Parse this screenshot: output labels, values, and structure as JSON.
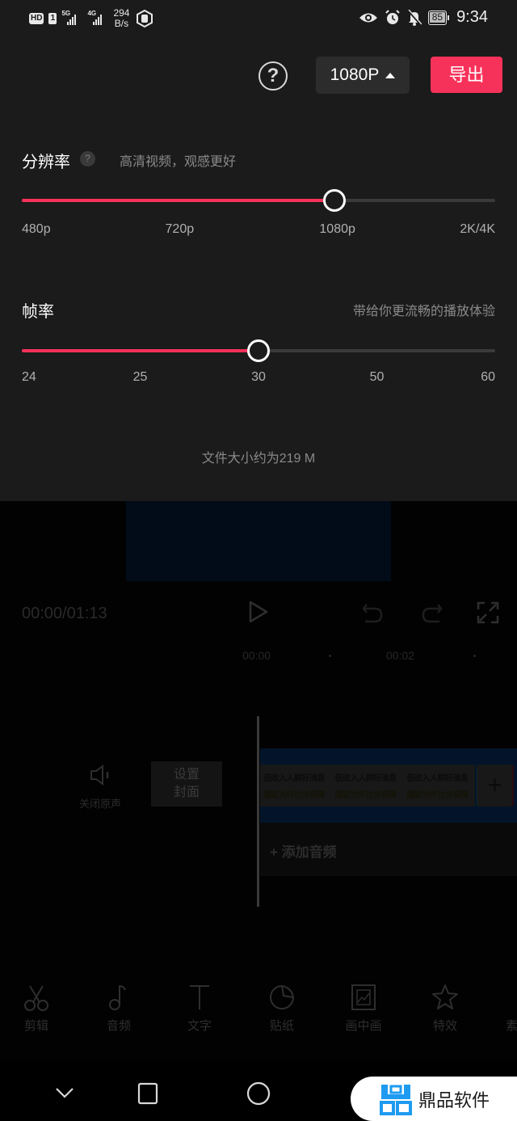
{
  "status_bar": {
    "hd_label": "HD",
    "sim_label": "1",
    "net1": "5G",
    "net2": "4G",
    "speed_value": "294",
    "speed_unit": "B/s",
    "battery": "85",
    "time": "9:34"
  },
  "export_panel": {
    "help_label": "?",
    "resolution_selected": "1080P",
    "export_label": "导出",
    "resolution": {
      "title": "分辨率",
      "help_badge": "?",
      "subtitle": "高清视频，观感更好",
      "options": [
        "480p",
        "720p",
        "1080p",
        "2K/4K"
      ],
      "selected": "1080p",
      "fill_fraction": 0.66
    },
    "frame_rate": {
      "title": "帧率",
      "subtitle": "带给你更流畅的播放体验",
      "options": [
        "24",
        "25",
        "30",
        "50",
        "60"
      ],
      "selected": "30",
      "fill_fraction": 0.5
    },
    "file_size": "文件大小约为219 M"
  },
  "editor": {
    "timecode": "00:00/01:13",
    "ruler_marks": [
      "00:00",
      "00:02"
    ],
    "mute_label": "关闭原声",
    "cover_label_1": "设置",
    "cover_label_2": "封面",
    "clip_frames": [
      {
        "line1": "低收入人群好消息",
        "line2": "国家关怀住房保障"
      },
      {
        "line1": "低收入人群好消息",
        "line2": "国家关怀住房保障"
      },
      {
        "line1": "低收入人群好消息",
        "line2": "国家关怀住房保障"
      }
    ],
    "add_clip_label": "+",
    "add_audio_label": "+ 添加音频",
    "tools": [
      {
        "label": "剪辑",
        "icon": "scissors-icon"
      },
      {
        "label": "音频",
        "icon": "music-note-icon"
      },
      {
        "label": "文字",
        "icon": "text-icon"
      },
      {
        "label": "贴纸",
        "icon": "sticker-icon"
      },
      {
        "label": "画中画",
        "icon": "picture-in-picture-icon"
      },
      {
        "label": "特效",
        "icon": "star-effect-icon"
      },
      {
        "label": "素",
        "icon": "material-icon"
      }
    ]
  },
  "nav_bar": {
    "watermark_text": "鼎品软件"
  },
  "colors": {
    "accent": "#f7325a",
    "panel_bg": "#1b1b1b",
    "watermark_blue": "#1e9bf0"
  }
}
